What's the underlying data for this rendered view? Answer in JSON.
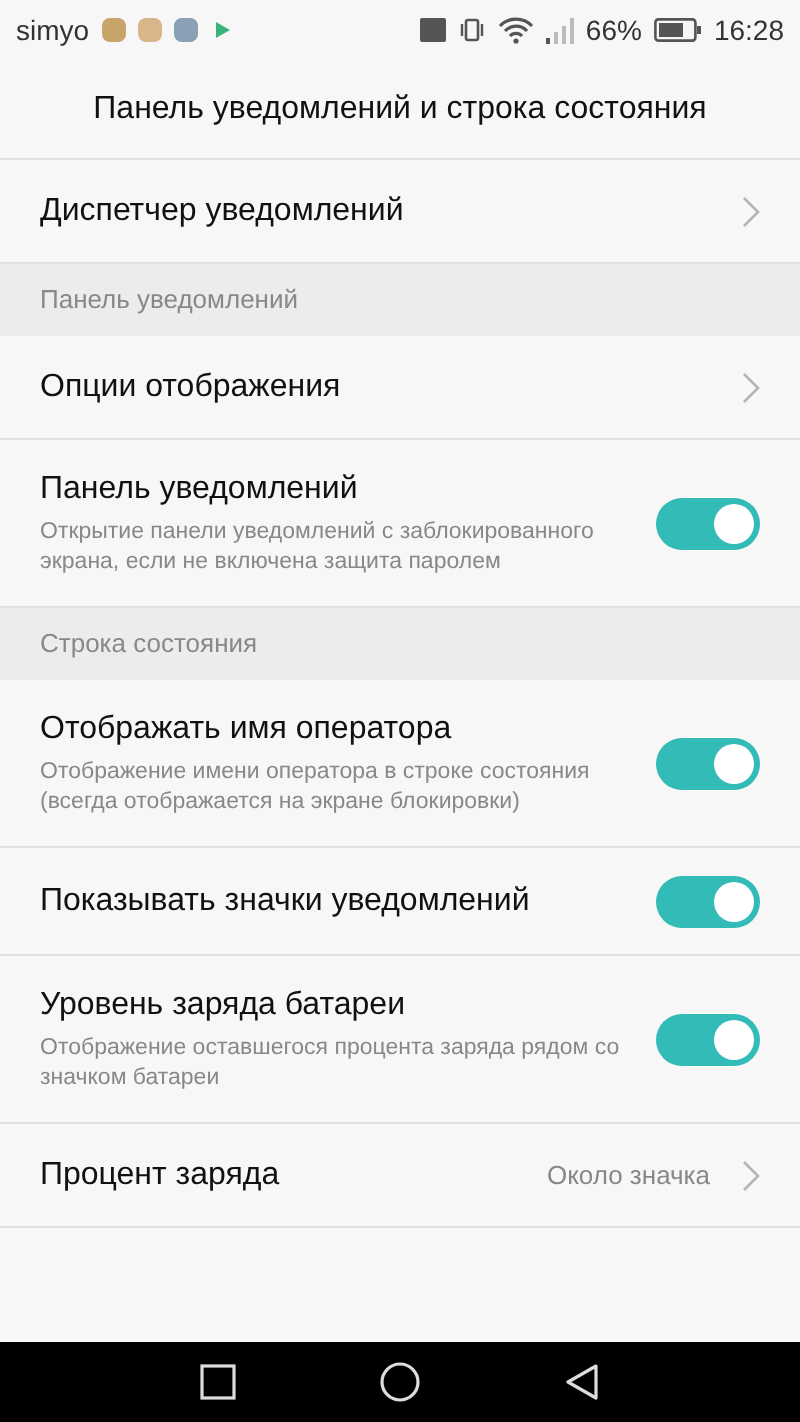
{
  "status_bar": {
    "carrier": "simyo",
    "battery_text": "66%",
    "time": "16:28"
  },
  "title": "Панель уведомлений и строка состояния",
  "items": [
    {
      "kind": "link",
      "label": "Диспетчер уведомлений"
    },
    {
      "kind": "section",
      "label": "Панель уведомлений"
    },
    {
      "kind": "link",
      "label": "Опции отображения"
    },
    {
      "kind": "toggle",
      "label": "Панель уведомлений",
      "description": "Открытие панели уведомлений с заблокированного экрана, если не включена защита паролем",
      "on": true
    },
    {
      "kind": "section",
      "label": "Строка состояния"
    },
    {
      "kind": "toggle",
      "label": "Отображать имя оператора",
      "description": "Отображение имени оператора в строке состояния (всегда отображается на экране блокировки)",
      "on": true
    },
    {
      "kind": "toggle",
      "label": "Показывать значки уведомлений",
      "on": true
    },
    {
      "kind": "toggle",
      "label": "Уровень заряда батареи",
      "description": "Отображение оставшегося процента заряда рядом со значком батареи",
      "on": true
    },
    {
      "kind": "link",
      "label": "Процент заряда",
      "value": "Около значка"
    }
  ]
}
